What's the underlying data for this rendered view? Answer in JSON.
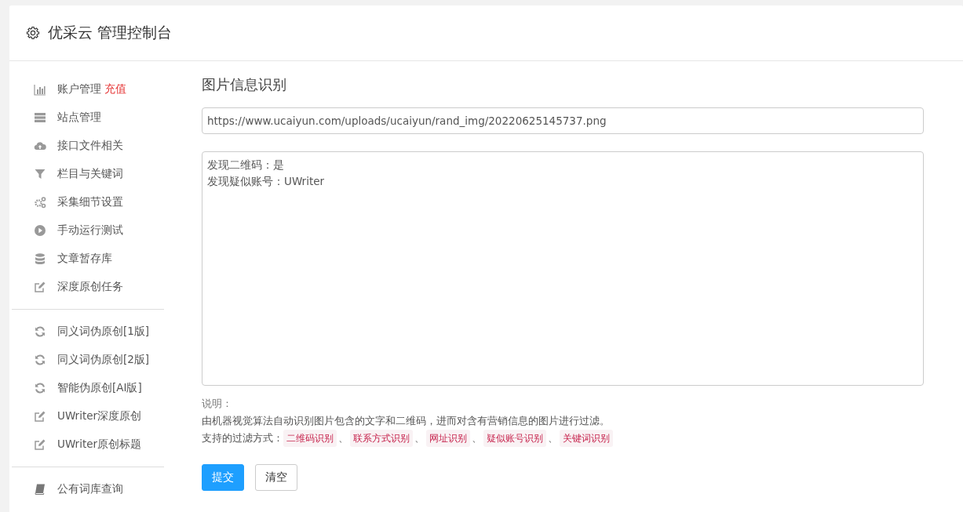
{
  "header": {
    "title": "优采云 管理控制台"
  },
  "sidebar": {
    "groups": [
      [
        {
          "kind": "bar-chart",
          "label": "账户管理",
          "badge": "充值"
        },
        {
          "kind": "server",
          "label": "站点管理"
        },
        {
          "kind": "cloud-upload",
          "label": "接口文件相关"
        },
        {
          "kind": "filter",
          "label": "栏目与关键词"
        },
        {
          "kind": "cogs",
          "label": "采集细节设置"
        },
        {
          "kind": "play",
          "label": "手动运行测试"
        },
        {
          "kind": "database",
          "label": "文章暂存库"
        },
        {
          "kind": "edit",
          "label": "深度原创任务"
        }
      ],
      [
        {
          "kind": "refresh",
          "label": "同义词伪原创[1版]"
        },
        {
          "kind": "refresh",
          "label": "同义词伪原创[2版]"
        },
        {
          "kind": "refresh",
          "label": "智能伪原创[AI版]"
        },
        {
          "kind": "edit",
          "label": "UWriter深度原创"
        },
        {
          "kind": "edit",
          "label": "UWriter原创标题"
        }
      ],
      [
        {
          "kind": "book",
          "label": "公有词库查询"
        }
      ]
    ]
  },
  "main": {
    "heading": "图片信息识别",
    "url_field": {
      "value": "https://www.ucaiyun.com/uploads/ucaiyun/rand_img/20220625145737.png"
    },
    "result_field": {
      "lines": [
        "发现二维码：是",
        "发现疑似账号：UWriter"
      ]
    },
    "note_label": "说明：",
    "note_text": "由机器视觉算法自动识别图片包含的文字和二维码，进而对含有营销信息的图片进行过滤。",
    "filter_methods": {
      "label": "支持的过滤方式：",
      "separator": "、",
      "tags": [
        "二维码识别",
        "联系方式识别",
        "网址识别",
        "疑似账号识别",
        "关键词识别"
      ]
    },
    "buttons": [
      {
        "kind": "primary",
        "label": "提交"
      },
      {
        "kind": "default",
        "label": "清空"
      }
    ]
  }
}
